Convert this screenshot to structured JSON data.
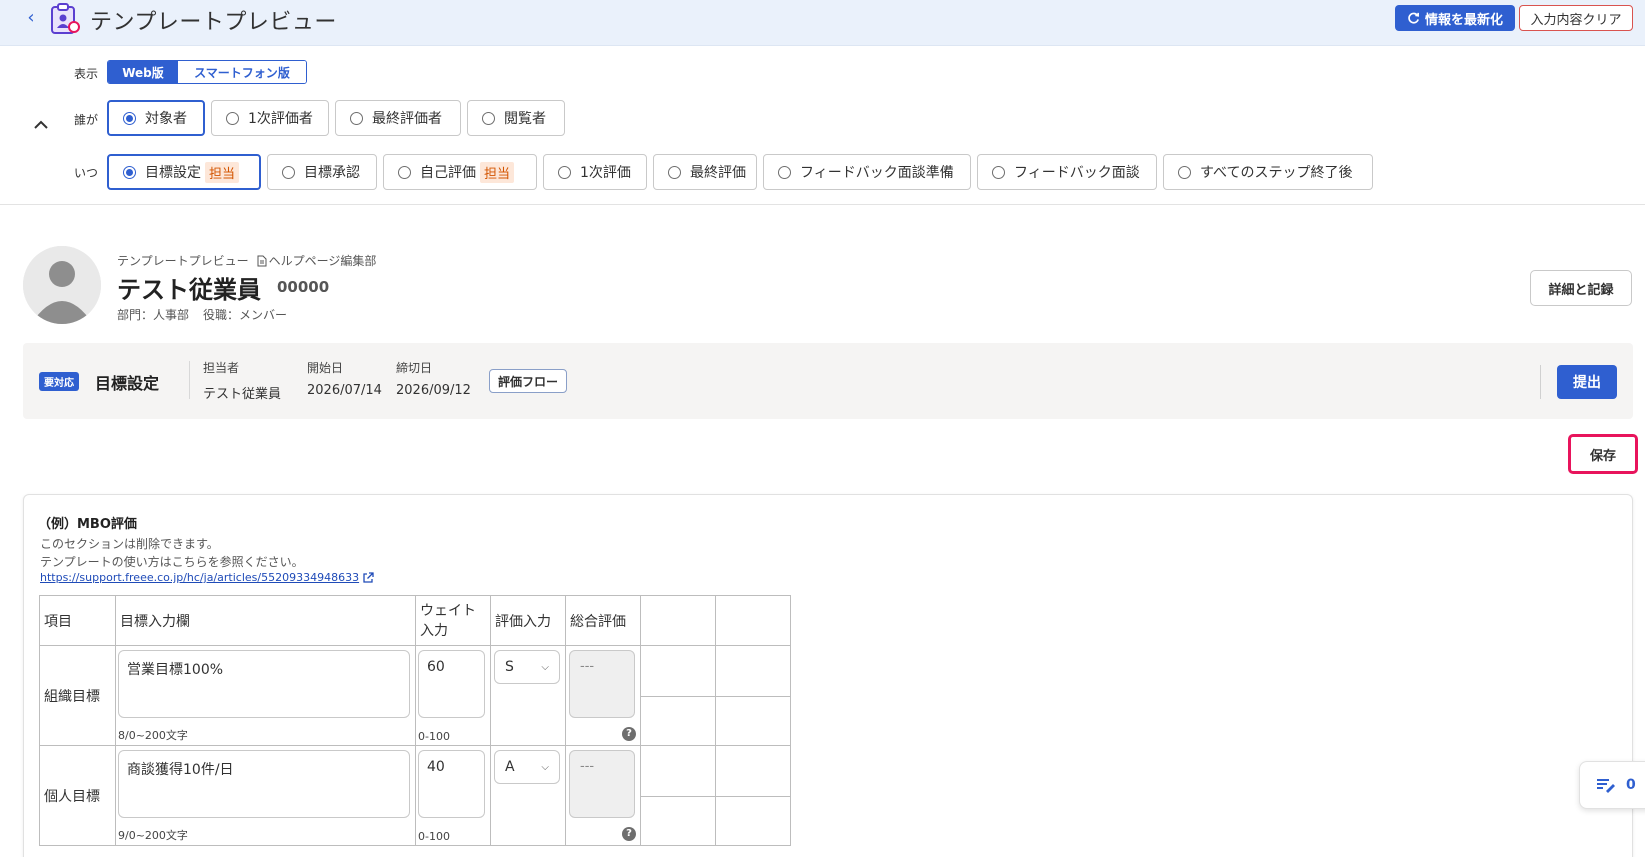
{
  "header": {
    "title": "テンプレートプレビュー",
    "refresh_label": "情報を最新化",
    "clear_label": "入力内容クリア"
  },
  "filters": {
    "display_label": "表示",
    "display_options": [
      "Web版",
      "スマートフォン版"
    ],
    "display_selected": "Web版",
    "who_label": "誰が",
    "who_options": [
      "対象者",
      "1次評価者",
      "最終評価者",
      "閲覧者"
    ],
    "who_selected": "対象者",
    "when_label": "いつ",
    "when_options": [
      {
        "label": "目標設定",
        "tag": "担当"
      },
      {
        "label": "目標承認",
        "tag": ""
      },
      {
        "label": "自己評価",
        "tag": "担当"
      },
      {
        "label": "1次評価",
        "tag": ""
      },
      {
        "label": "最終評価",
        "tag": ""
      },
      {
        "label": "フィードバック面談準備",
        "tag": ""
      },
      {
        "label": "フィードバック面談",
        "tag": ""
      },
      {
        "label": "すべてのステップ終了後",
        "tag": ""
      }
    ],
    "when_selected": "目標設定"
  },
  "profile": {
    "breadcrumb_1": "テンプレートプレビュー",
    "breadcrumb_2": "ヘルプページ編集部",
    "name": "テスト従業員",
    "employee_id": "00000",
    "department": "部門：人事部",
    "role": "役職：メンバー",
    "detail_label": "詳細と記録"
  },
  "step": {
    "badge": "要対応",
    "title": "目標設定",
    "assignee_label": "担当者",
    "assignee": "テスト従業員",
    "start_label": "開始日",
    "start": "2026/07/14",
    "due_label": "締切日",
    "due": "2026/09/12",
    "flow_label": "評価フロー",
    "submit_label": "提出"
  },
  "save_label": "保存",
  "section": {
    "title": "（例）MBO評価",
    "desc_1": "このセクションは削除できます。",
    "desc_2": "テンプレートの使い方はこちらを参照ください。",
    "link": "https://support.freee.co.jp/hc/ja/articles/55209334948633",
    "headers": [
      "項目",
      "目標入力欄",
      "ウェイト入力",
      "評価入力",
      "総合評価"
    ],
    "rows": [
      {
        "item": "組織目標",
        "goal": "営業目標100%",
        "goal_hint": "8/0~200文字",
        "weight": "60",
        "weight_hint": "0-100",
        "rating": "S",
        "total": "---"
      },
      {
        "item": "個人目標",
        "goal": "商談獲得10件/日",
        "goal_hint": "9/0~200文字",
        "weight": "40",
        "weight_hint": "0-100",
        "rating": "A",
        "total": "---"
      }
    ]
  },
  "comment_count": "0",
  "colors": {
    "primary": "#2f5fd0",
    "header_bg": "#eaf1fb",
    "highlight": "#e8145c",
    "tag_bg": "#fde7d9"
  }
}
